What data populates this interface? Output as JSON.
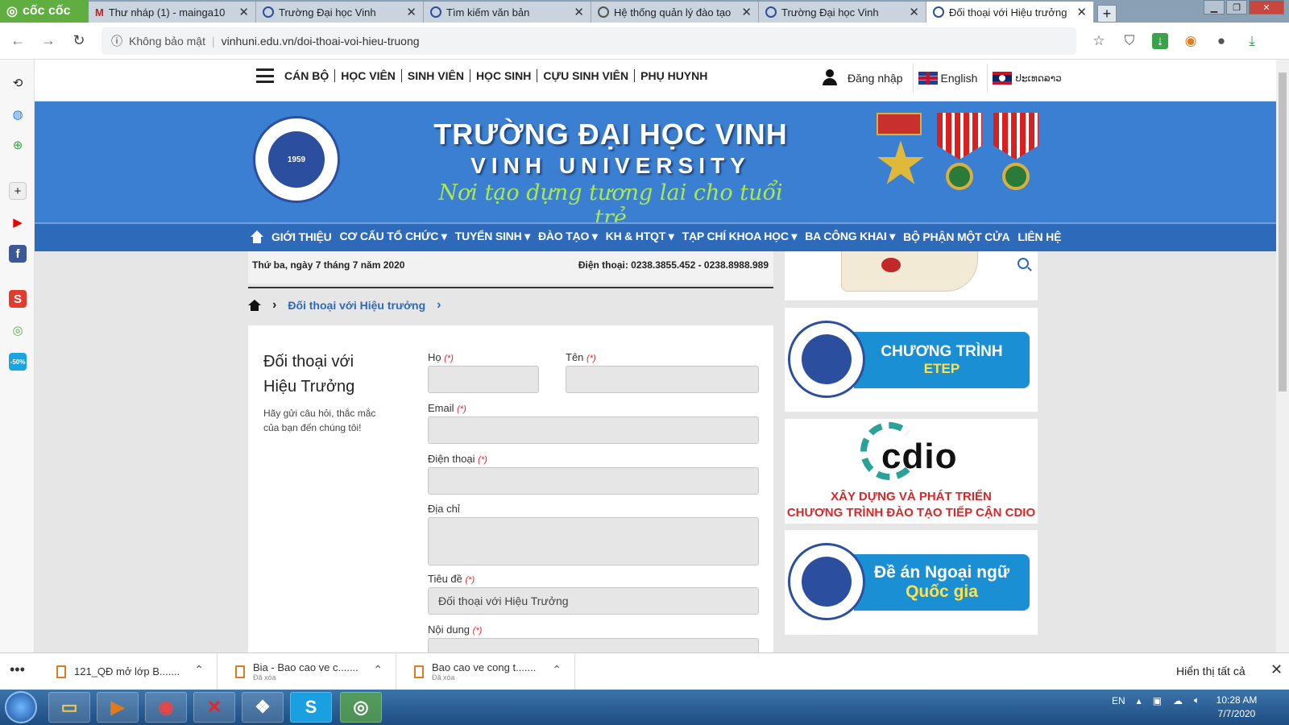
{
  "browser": {
    "brand": "cốc cốc",
    "tabs": [
      {
        "label": "Thư nháp (1) - mainga10",
        "icon": "gmail-icon",
        "active": false
      },
      {
        "label": "Trường Đại học Vinh",
        "icon": "site-icon",
        "active": false
      },
      {
        "label": "Tìm kiếm văn bản",
        "icon": "site-icon",
        "active": false
      },
      {
        "label": "Hệ thống quản lý đào tạo",
        "icon": "globe-icon",
        "active": false
      },
      {
        "label": "Trường Đại học Vinh",
        "icon": "site-icon",
        "active": false
      },
      {
        "label": "Đối thoại với Hiệu trưởng",
        "icon": "site-icon",
        "active": true
      }
    ],
    "new_tab": "+",
    "security_label": "Không bảo mật",
    "url": "vinhuni.edu.vn/doi-thoai-voi-hieu-truong"
  },
  "site": {
    "roles": [
      "CÁN BỘ",
      "HỌC VIÊN",
      "SINH VIÊN",
      "HỌC SINH",
      "CỰU SINH VIÊN",
      "PHỤ HUYNH"
    ],
    "login": "Đăng nhập",
    "lang_en": "English",
    "lang_lo": "ປະເທດລາວ",
    "banner": {
      "logo_text": "1959",
      "title": "TRƯỜNG ĐẠI HỌC VINH",
      "subtitle": "VINH UNIVERSITY",
      "slogan": "Nơi tạo dựng tương lai cho tuổi trẻ"
    },
    "nav": [
      "GIỚI THIỆU",
      "CƠ CẤU TỔ CHỨC ▾",
      "TUYỂN SINH ▾",
      "ĐÀO TẠO ▾",
      "KH & HTQT ▾",
      "TẠP CHÍ KHOA HỌC ▾",
      "BA CÔNG KHAI ▾",
      "BỘ PHẬN MỘT CỬA",
      "LIÊN HỆ"
    ],
    "date": "Thứ ba, ngày 7 tháng 7 năm 2020",
    "phone": "Điện thoại: 0238.3855.452 - 0238.8988.989",
    "breadcrumb": "Đối thoại với Hiệu trưởng"
  },
  "form": {
    "title": "Đối thoại với Hiệu Trưởng",
    "desc": "Hãy gửi câu hỏi, thắc mắc của bạn đến chúng tôi!",
    "required_mark": "(*)",
    "ho_label": "Họ",
    "ten_label": "Tên",
    "email_label": "Email",
    "phone_label": "Điện thoại",
    "address_label": "Địa chỉ",
    "subject_label": "Tiêu đề",
    "subject_value": "Đối thoại với Hiệu Trưởng",
    "content_label": "Nội dung"
  },
  "sidebar_ads": {
    "etep_a": "CHƯƠNG TRÌNH",
    "etep_b": "ETEP",
    "cdio_word": "cdio",
    "cdio_l1": "XÂY DỰNG VÀ PHÁT TRIỂN",
    "cdio_l2": "CHƯƠNG TRÌNH ĐÀO TẠO TIẾP CẬN CDIO",
    "ngoaingu_a": "Đề án Ngoại ngữ",
    "ngoaingu_b": "Quốc gia"
  },
  "downloads": {
    "items": [
      {
        "name": "121_QĐ mở lớp B.......",
        "status": ""
      },
      {
        "name": "Bia - Bao cao ve c.......",
        "status": "Đã xóa"
      },
      {
        "name": "Bao cao ve cong t.......",
        "status": "Đã xóa"
      }
    ],
    "show_all": "Hiển thị tất cả"
  },
  "taskbar": {
    "lang": "EN",
    "time": "10:28 AM",
    "date": "7/7/2020"
  }
}
